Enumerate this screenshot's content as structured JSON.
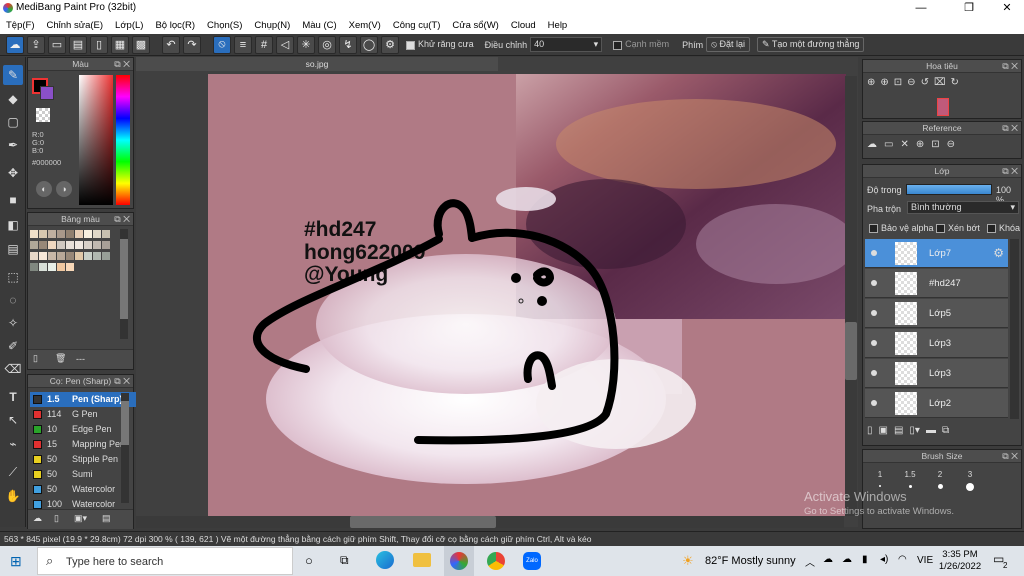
{
  "window": {
    "title": "MediBang Paint Pro (32bit)",
    "controls": [
      "—",
      "❐",
      "✕"
    ]
  },
  "menu": [
    "Tệp(F)",
    "Chỉnh sửa(E)",
    "Lớp(L)",
    "Bộ lọc(R)",
    "Chọn(S)",
    "Chụp(N)",
    "Màu (C)",
    "Xem(V)",
    "Công cụ(T)",
    "Cửa sổ(W)",
    "Cloud",
    "Help"
  ],
  "toolbar": {
    "antialias_label": "Khử răng cưa",
    "correction_label": "Điều chỉnh",
    "correction_value": "40",
    "edge_label": "Cạnh mềm",
    "key_label": "Phím",
    "reset_label": "Đặt lại",
    "line_label": "Tạo một đường thẳng"
  },
  "color_panel": {
    "title": "Màu",
    "r": "R:0",
    "g": "G:0",
    "b": "B:0",
    "hex": "#000000"
  },
  "palette_panel": {
    "title": "Bảng màu",
    "footer": "---"
  },
  "brush_panel": {
    "title": "Cọ: Pen (Sharp)",
    "items": [
      {
        "size": "1.5",
        "name": "Pen (Sharp)",
        "color": "#333333"
      },
      {
        "size": "114",
        "name": "G Pen",
        "color": "#e03030"
      },
      {
        "size": "10",
        "name": "Edge Pen",
        "color": "#2aa52a"
      },
      {
        "size": "15",
        "name": "Mapping Pen",
        "color": "#e03030"
      },
      {
        "size": "50",
        "name": "Stipple Pen",
        "color": "#e8d020"
      },
      {
        "size": "50",
        "name": "Sumi",
        "color": "#e8d020"
      },
      {
        "size": "50",
        "name": "Watercolor",
        "color": "#40a0e0"
      },
      {
        "size": "100",
        "name": "Watercolor",
        "color": "#40a0e0"
      }
    ]
  },
  "document": {
    "tab": "so.jpg",
    "text_lines": [
      "#hd247",
      "hong622009",
      "@Young"
    ]
  },
  "navigator": {
    "title": "Hoa tiêu"
  },
  "reference": {
    "title": "Reference"
  },
  "layers": {
    "title": "Lớp",
    "opacity_label": "Độ trong",
    "opacity_value": "100 %",
    "opacity": 1.0,
    "blend_label": "Pha trộn",
    "blend_value": "Bình thường",
    "protect_alpha": "Bảo vệ alpha",
    "clipping": "Xén bớt",
    "lock": "Khóa",
    "items": [
      {
        "name": "Lớp7",
        "selected": true
      },
      {
        "name": "#hd247",
        "selected": false
      },
      {
        "name": "Lớp5",
        "selected": false
      },
      {
        "name": "Lớp3",
        "selected": false
      },
      {
        "name": "Lớp3",
        "selected": false
      },
      {
        "name": "Lớp2",
        "selected": false
      }
    ]
  },
  "brush_size": {
    "title": "Brush Size",
    "sizes": [
      "1",
      "1.5",
      "2",
      "3"
    ]
  },
  "watermark": {
    "line1": "Activate Windows",
    "line2": "Go to Settings to activate Windows."
  },
  "status": "563 * 845 pixel  (19.9 * 29.8cm)  72 dpi  300 %  ( 139, 621 )  Vẽ một đường thẳng bằng cách giữ phím Shift, Thay đổi cỡ cọ bằng cách giữ phím Ctrl, Alt và kéo",
  "taskbar": {
    "search_placeholder": "Type here to search",
    "weather": "82°F  Mostly sunny",
    "lang": "VIE",
    "time": "3:35 PM",
    "date": "1/26/2022",
    "notif": "2"
  }
}
